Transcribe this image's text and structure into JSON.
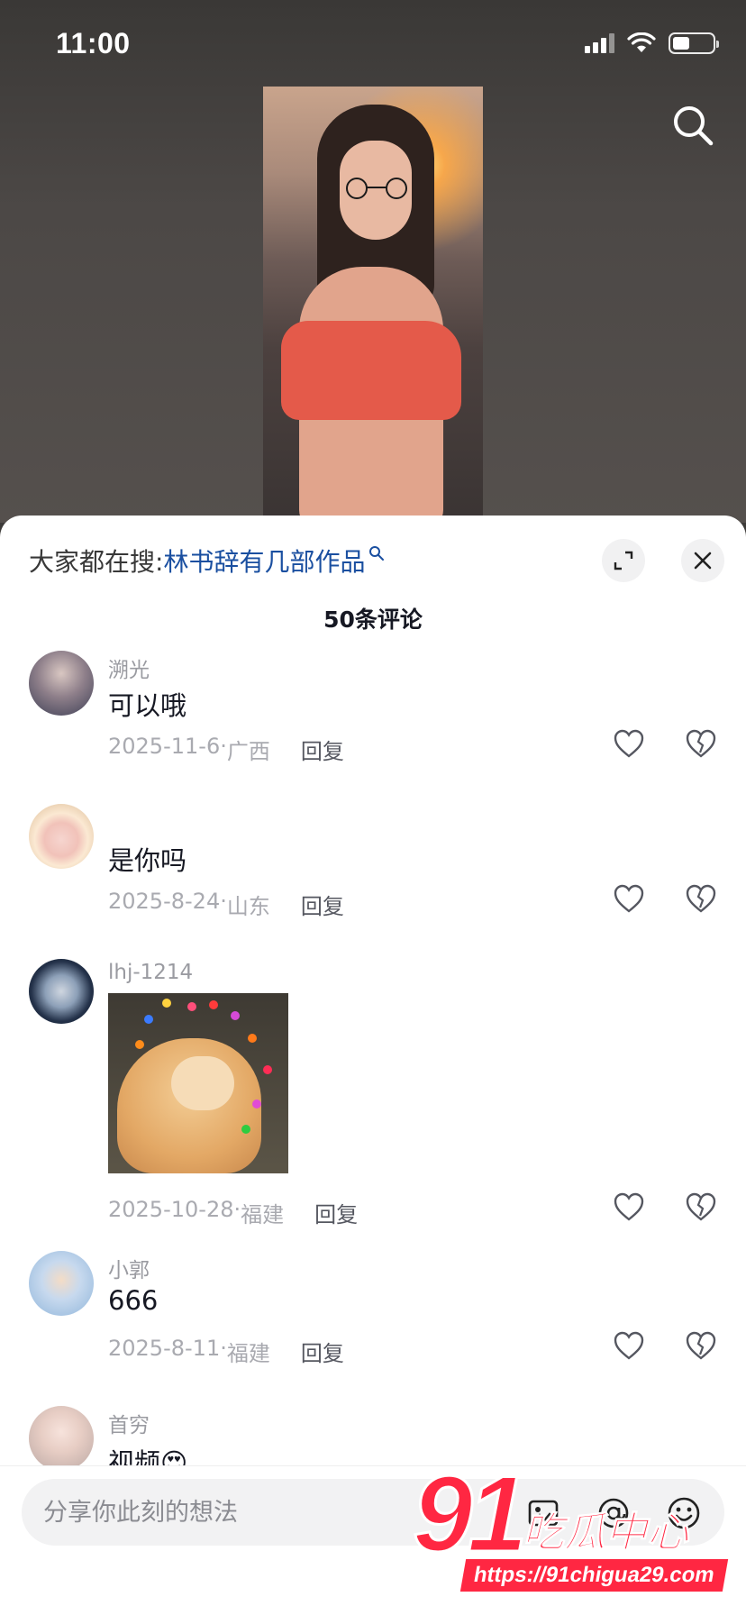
{
  "status_bar": {
    "time": "11:00"
  },
  "sheet": {
    "hot_search_prefix": "大家都在搜:",
    "hot_search_keyword": "林书辞有几部作品",
    "comment_count": "50条评论"
  },
  "comments": [
    {
      "nick": "溯光",
      "text": "可以哦",
      "date": "2025-11-6",
      "location": "广西",
      "reply": "回复"
    },
    {
      "nick": "",
      "text": "是你吗",
      "date": "2025-8-24",
      "location": "山东",
      "reply": "回复"
    },
    {
      "nick": "lhj-1214",
      "text": "",
      "date": "2025-10-28",
      "location": "福建",
      "reply": "回复"
    },
    {
      "nick": "小郭",
      "text": "666",
      "date": "2025-8-11",
      "location": "福建",
      "reply": "回复"
    },
    {
      "nick": "首穷",
      "text": "视频😍"
    }
  ],
  "input": {
    "placeholder": "分享你此刻的想法"
  },
  "watermark": {
    "number": "91",
    "name": "吃瓜中心",
    "url": "https://91chigua29.com"
  },
  "colors": {
    "accent_red": "#ff2742",
    "link_blue": "#1a4fa0"
  }
}
